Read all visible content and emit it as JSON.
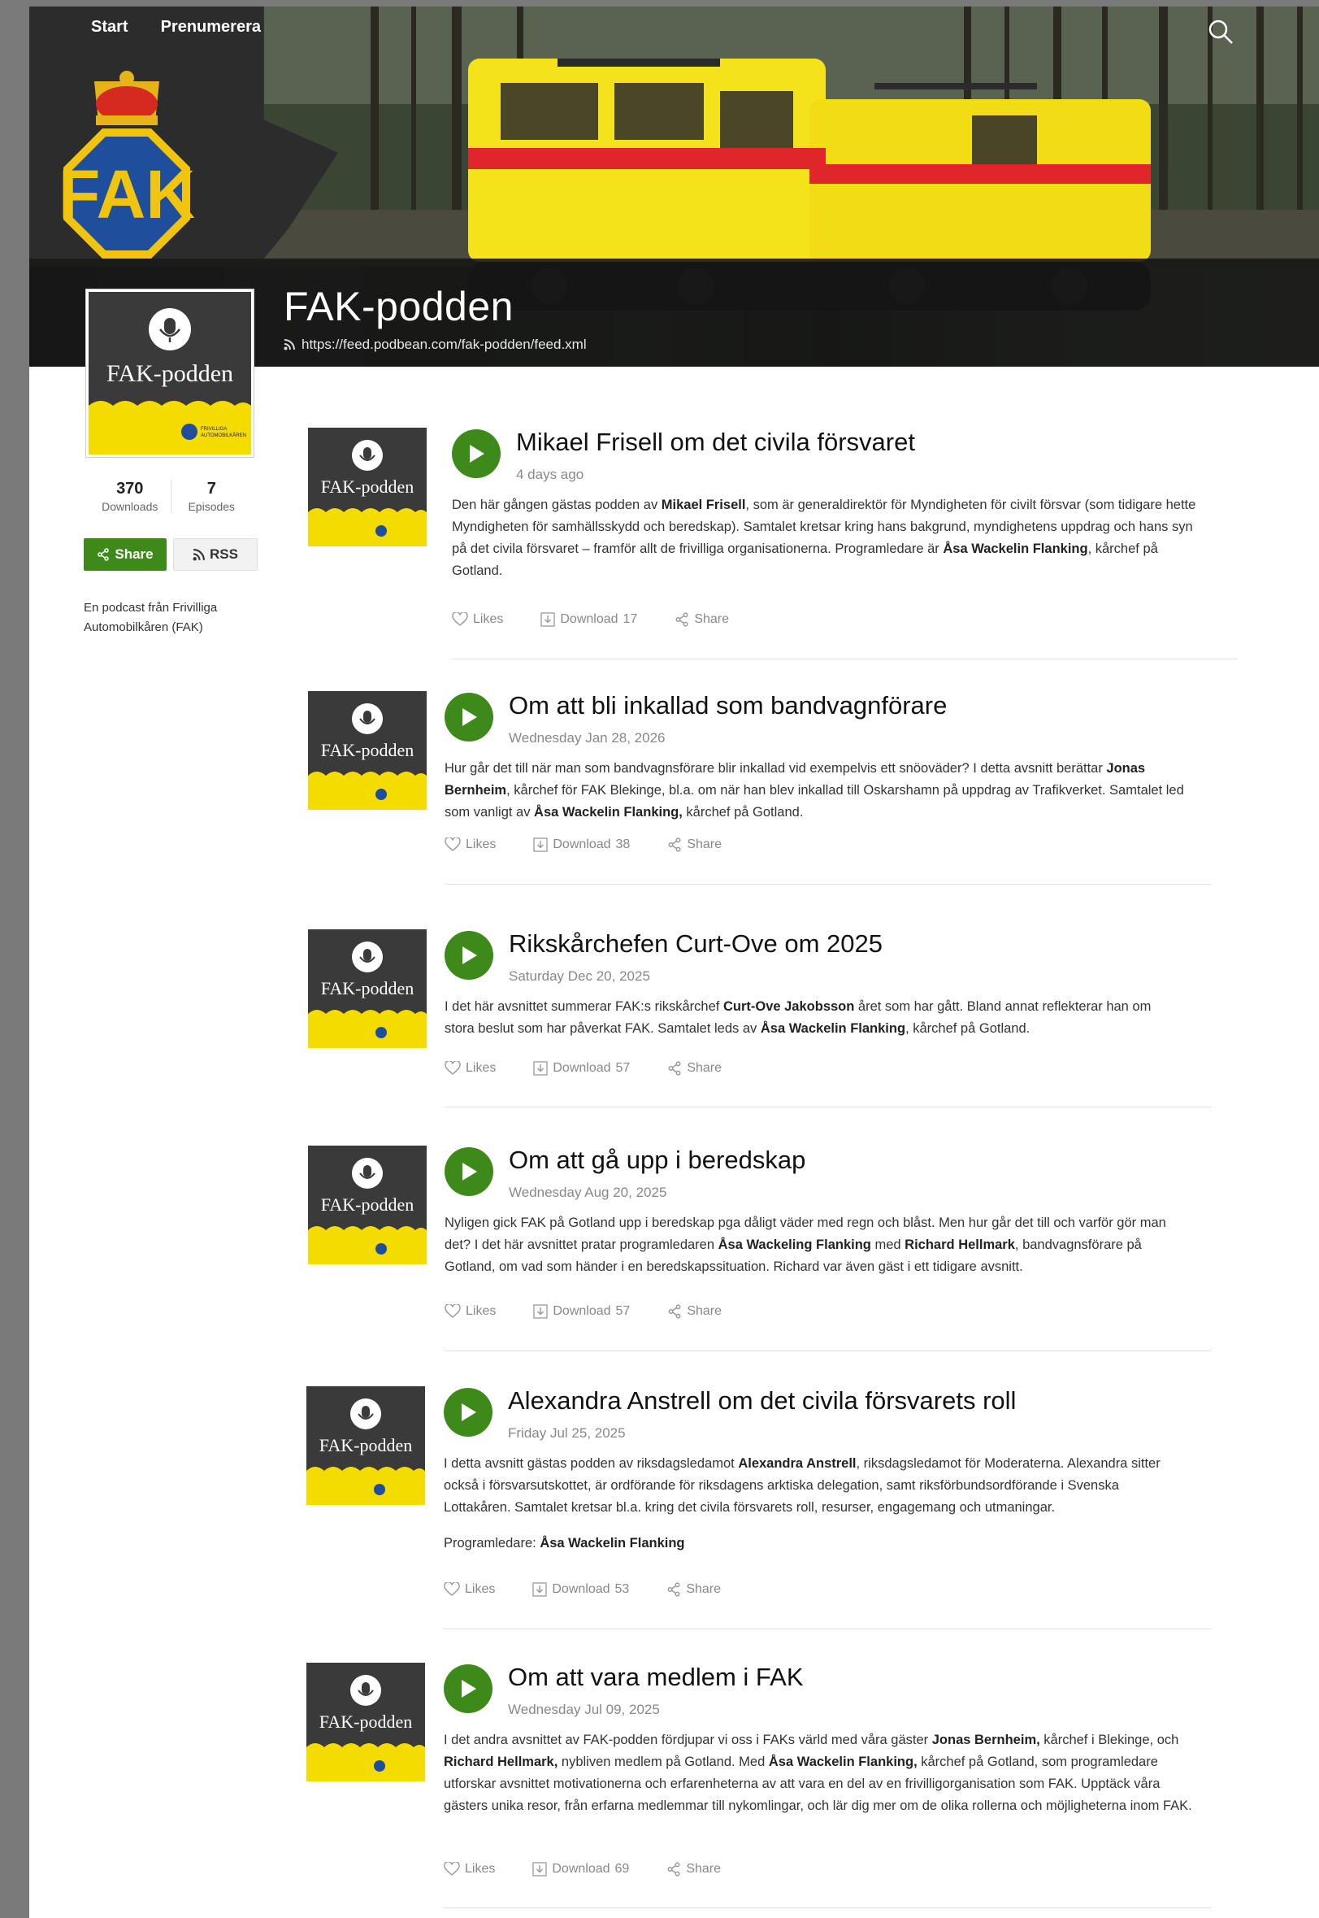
{
  "nav": {
    "start": "Start",
    "subscribe": "Prenumerera"
  },
  "logo": {
    "text": "FAK"
  },
  "podcast": {
    "title": "FAK-podden",
    "feed_url": "https://feed.podbean.com/fak-podden/feed.xml",
    "cover_title": "FAK-podden",
    "cover_caption_line1": "FRIVILLIGA",
    "cover_caption_line2": "AUTOMOBILKÅREN"
  },
  "stats": {
    "downloads_value": "370",
    "downloads_label": "Downloads",
    "episodes_value": "7",
    "episodes_label": "Episodes"
  },
  "buttons": {
    "share": "Share",
    "rss": "RSS"
  },
  "about": "En podcast från Frivilliga Automobilkåren (FAK)",
  "action_labels": {
    "likes": "Likes",
    "download": "Download",
    "share": "Share"
  },
  "episodes": [
    {
      "title": "Mikael Frisell om det civila försvaret",
      "date": "4 days ago",
      "desc_parts": [
        "Den här gången gästas podden av ",
        "Mikael Frisell",
        ", som är generaldirektör för Myndigheten för civilt försvar (som tidigare hette Myndigheten för samhällsskydd och beredskap). Samtalet kretsar kring hans bakgrund, myndighetens uppdrag och hans syn på det civila försvaret – framför allt de frivilliga organisationerna. Programledare är ",
        "Åsa Wackelin Flanking",
        ", kårchef på Gotland."
      ],
      "downloads": "17"
    },
    {
      "title": "Om att bli inkallad som bandvagnförare",
      "date": "Wednesday Jan 28, 2026",
      "desc_parts": [
        "Hur går det till när man som bandvagnsförare blir inkallad vid exempelvis ett snöoväder? I detta avsnitt berättar ",
        "Jonas Bernheim",
        ", kårchef för FAK Blekinge, bl.a. om när han blev inkallad till Oskarshamn på uppdrag av Trafikverket. Samtalet led som vanligt av ",
        "Åsa Wackelin Flanking,",
        " kårchef på Gotland."
      ],
      "downloads": "38"
    },
    {
      "title": "Rikskårchefen Curt-Ove om 2025",
      "date": "Saturday Dec 20, 2025",
      "desc_parts": [
        "I det här avsnittet summerar FAK:s rikskårchef ",
        "Curt-Ove Jakobsson",
        " året som har gått. Bland annat reflekterar han om stora beslut som har påverkat FAK. Samtalet leds av ",
        "Åsa Wackelin Flanking",
        ", kårchef på Gotland."
      ],
      "downloads": "57"
    },
    {
      "title": "Om att gå upp i beredskap",
      "date": "Wednesday Aug 20, 2025",
      "desc_parts": [
        "Nyligen gick FAK på Gotland upp i beredskap pga dåligt väder med regn och blåst. Men hur går det till och varför gör man det? I det här avsnittet pratar programledaren ",
        "Åsa Wackeling Flanking",
        " med ",
        "Richard Hellmark",
        ", bandvagnsförare på Gotland, om vad som händer i en beredskapssituation. Richard var även gäst i ett tidigare avsnitt."
      ],
      "downloads": "57"
    },
    {
      "title": "Alexandra Anstrell om det civila försvarets roll",
      "date": "Friday Jul 25, 2025",
      "desc_parts": [
        "I detta avsnitt gästas podden av riksdagsledamot ",
        "Alexandra Anstrell",
        ", riksdagsledamot för Moderaterna. Alexandra sitter också i försvarsutskottet, är ordförande för riksdagens arktiska delegation, samt riksförbundsordförande i Svenska Lottakåren. Samtalet kretsar bl.a. kring det civila försvarets roll, resurser, engagemang och utmaningar."
      ],
      "extra_prefix": "Programledare: ",
      "extra_bold": "Åsa Wackelin Flanking",
      "downloads": "53"
    },
    {
      "title": "Om att vara medlem i FAK",
      "date": "Wednesday Jul 09, 2025",
      "desc_parts": [
        "I det andra avsnittet av FAK-podden fördjupar vi oss i FAKs värld med våra gäster ",
        "Jonas Bernheim,",
        " kårchef i Blekinge, och ",
        "Richard Hellmark,",
        " nybliven medlem på Gotland. Med ",
        "Åsa Wackelin Flanking,",
        " kårchef på Gotland, som programledare utforskar avsnittet motivationerna och erfarenheterna av att vara en del av en frivilligorganisation som FAK. Upptäck våra gästers unika resor, från erfarna medlemmar till nykomlingar, och lär dig mer om de olika rollerna och möjligheterna inom FAK."
      ],
      "downloads": "69"
    }
  ]
}
